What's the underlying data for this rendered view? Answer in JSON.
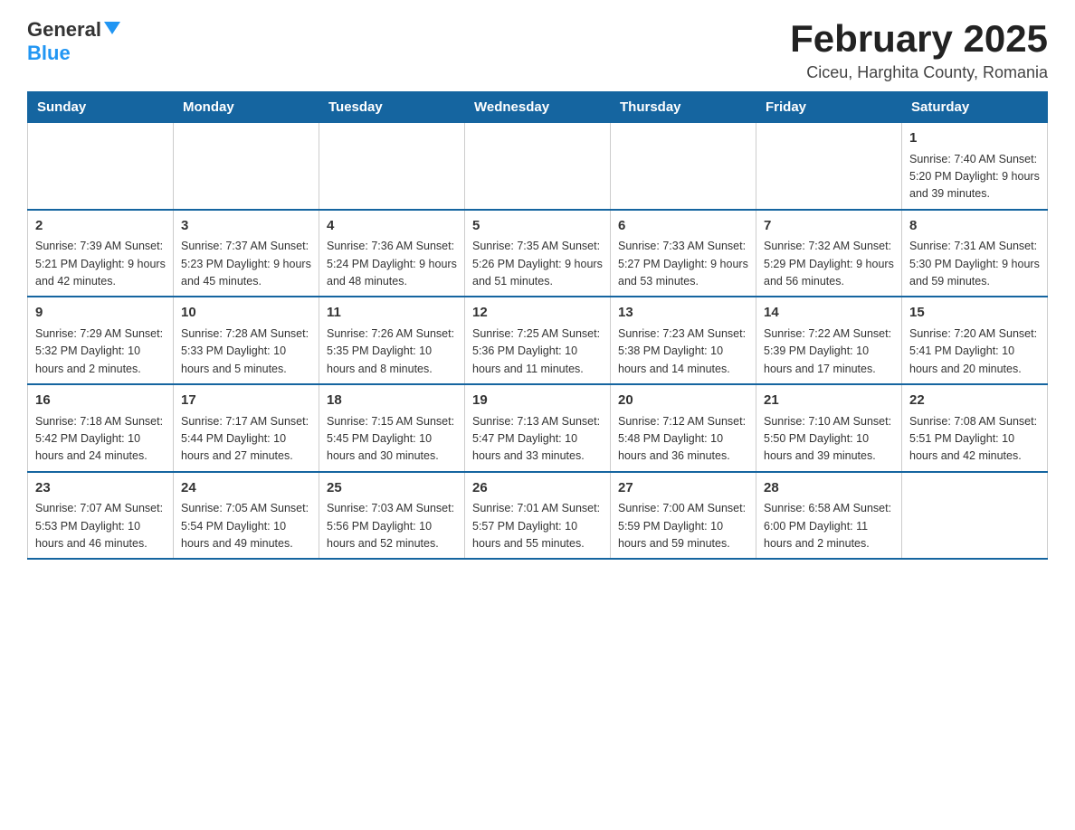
{
  "header": {
    "logo": {
      "general": "General",
      "blue": "Blue"
    },
    "title": "February 2025",
    "location": "Ciceu, Harghita County, Romania"
  },
  "days_of_week": [
    "Sunday",
    "Monday",
    "Tuesday",
    "Wednesday",
    "Thursday",
    "Friday",
    "Saturday"
  ],
  "weeks": [
    [
      {
        "day": "",
        "info": ""
      },
      {
        "day": "",
        "info": ""
      },
      {
        "day": "",
        "info": ""
      },
      {
        "day": "",
        "info": ""
      },
      {
        "day": "",
        "info": ""
      },
      {
        "day": "",
        "info": ""
      },
      {
        "day": "1",
        "info": "Sunrise: 7:40 AM\nSunset: 5:20 PM\nDaylight: 9 hours and 39 minutes."
      }
    ],
    [
      {
        "day": "2",
        "info": "Sunrise: 7:39 AM\nSunset: 5:21 PM\nDaylight: 9 hours and 42 minutes."
      },
      {
        "day": "3",
        "info": "Sunrise: 7:37 AM\nSunset: 5:23 PM\nDaylight: 9 hours and 45 minutes."
      },
      {
        "day": "4",
        "info": "Sunrise: 7:36 AM\nSunset: 5:24 PM\nDaylight: 9 hours and 48 minutes."
      },
      {
        "day": "5",
        "info": "Sunrise: 7:35 AM\nSunset: 5:26 PM\nDaylight: 9 hours and 51 minutes."
      },
      {
        "day": "6",
        "info": "Sunrise: 7:33 AM\nSunset: 5:27 PM\nDaylight: 9 hours and 53 minutes."
      },
      {
        "day": "7",
        "info": "Sunrise: 7:32 AM\nSunset: 5:29 PM\nDaylight: 9 hours and 56 minutes."
      },
      {
        "day": "8",
        "info": "Sunrise: 7:31 AM\nSunset: 5:30 PM\nDaylight: 9 hours and 59 minutes."
      }
    ],
    [
      {
        "day": "9",
        "info": "Sunrise: 7:29 AM\nSunset: 5:32 PM\nDaylight: 10 hours and 2 minutes."
      },
      {
        "day": "10",
        "info": "Sunrise: 7:28 AM\nSunset: 5:33 PM\nDaylight: 10 hours and 5 minutes."
      },
      {
        "day": "11",
        "info": "Sunrise: 7:26 AM\nSunset: 5:35 PM\nDaylight: 10 hours and 8 minutes."
      },
      {
        "day": "12",
        "info": "Sunrise: 7:25 AM\nSunset: 5:36 PM\nDaylight: 10 hours and 11 minutes."
      },
      {
        "day": "13",
        "info": "Sunrise: 7:23 AM\nSunset: 5:38 PM\nDaylight: 10 hours and 14 minutes."
      },
      {
        "day": "14",
        "info": "Sunrise: 7:22 AM\nSunset: 5:39 PM\nDaylight: 10 hours and 17 minutes."
      },
      {
        "day": "15",
        "info": "Sunrise: 7:20 AM\nSunset: 5:41 PM\nDaylight: 10 hours and 20 minutes."
      }
    ],
    [
      {
        "day": "16",
        "info": "Sunrise: 7:18 AM\nSunset: 5:42 PM\nDaylight: 10 hours and 24 minutes."
      },
      {
        "day": "17",
        "info": "Sunrise: 7:17 AM\nSunset: 5:44 PM\nDaylight: 10 hours and 27 minutes."
      },
      {
        "day": "18",
        "info": "Sunrise: 7:15 AM\nSunset: 5:45 PM\nDaylight: 10 hours and 30 minutes."
      },
      {
        "day": "19",
        "info": "Sunrise: 7:13 AM\nSunset: 5:47 PM\nDaylight: 10 hours and 33 minutes."
      },
      {
        "day": "20",
        "info": "Sunrise: 7:12 AM\nSunset: 5:48 PM\nDaylight: 10 hours and 36 minutes."
      },
      {
        "day": "21",
        "info": "Sunrise: 7:10 AM\nSunset: 5:50 PM\nDaylight: 10 hours and 39 minutes."
      },
      {
        "day": "22",
        "info": "Sunrise: 7:08 AM\nSunset: 5:51 PM\nDaylight: 10 hours and 42 minutes."
      }
    ],
    [
      {
        "day": "23",
        "info": "Sunrise: 7:07 AM\nSunset: 5:53 PM\nDaylight: 10 hours and 46 minutes."
      },
      {
        "day": "24",
        "info": "Sunrise: 7:05 AM\nSunset: 5:54 PM\nDaylight: 10 hours and 49 minutes."
      },
      {
        "day": "25",
        "info": "Sunrise: 7:03 AM\nSunset: 5:56 PM\nDaylight: 10 hours and 52 minutes."
      },
      {
        "day": "26",
        "info": "Sunrise: 7:01 AM\nSunset: 5:57 PM\nDaylight: 10 hours and 55 minutes."
      },
      {
        "day": "27",
        "info": "Sunrise: 7:00 AM\nSunset: 5:59 PM\nDaylight: 10 hours and 59 minutes."
      },
      {
        "day": "28",
        "info": "Sunrise: 6:58 AM\nSunset: 6:00 PM\nDaylight: 11 hours and 2 minutes."
      },
      {
        "day": "",
        "info": ""
      }
    ]
  ]
}
